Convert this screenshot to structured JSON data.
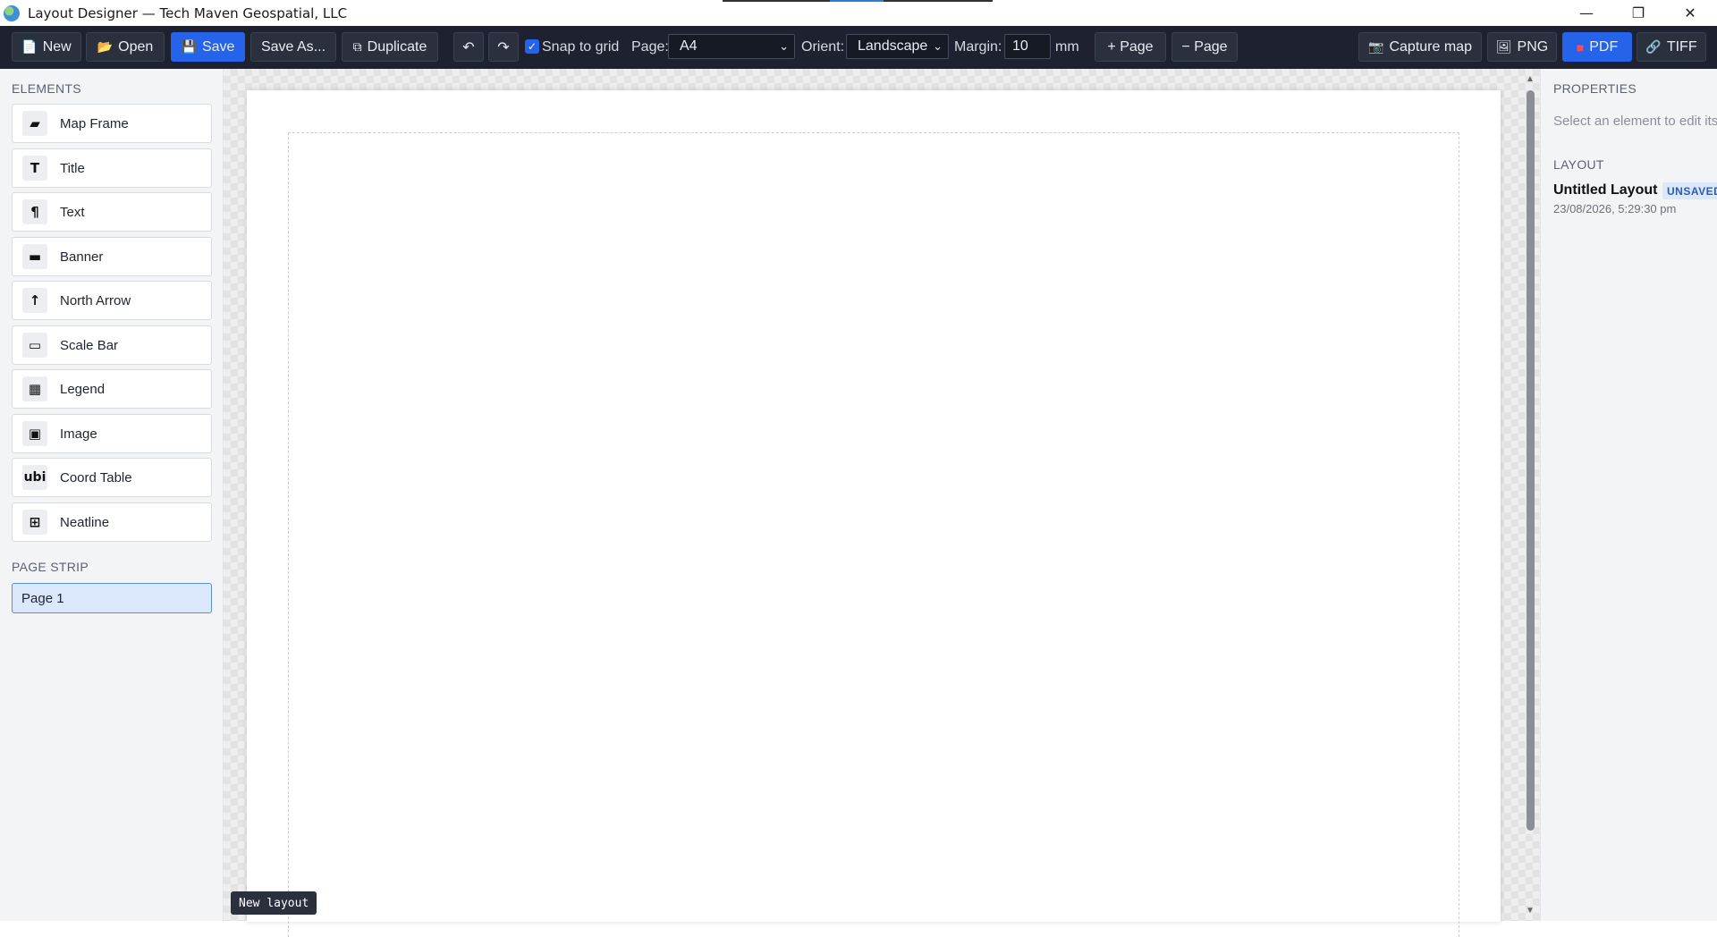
{
  "window": {
    "title": "Layout Designer — Tech Maven Geospatial, LLC",
    "controls": {
      "minimize": "—",
      "restore": "❐",
      "close": "✕"
    }
  },
  "toolbar": {
    "new": "New",
    "open": "Open",
    "save": "Save",
    "save_as": "Save As...",
    "duplicate": "Duplicate",
    "undo": "↶",
    "redo": "↷",
    "snap_to_grid": {
      "label": "Snap to grid",
      "checked": true
    },
    "page_label": "Page:",
    "page_value": "A4",
    "orient_label": "Orient:",
    "orient_value": "Landscape",
    "margin_label": "Margin:",
    "margin_value": "10",
    "margin_unit": "mm",
    "add_page": "+ Page",
    "remove_page": "− Page",
    "capture_map": "Capture map",
    "png": "PNG",
    "pdf": "PDF",
    "tiff": "TIFF",
    "accent_color": "#2563eb"
  },
  "sidebar": {
    "elements_heading": "ELEMENTS",
    "items": [
      {
        "label": "Map Frame",
        "icon": "map-frame-icon",
        "glyph": "▰"
      },
      {
        "label": "Title",
        "icon": "title-icon",
        "glyph": "T"
      },
      {
        "label": "Text",
        "icon": "text-icon",
        "glyph": "¶"
      },
      {
        "label": "Banner",
        "icon": "banner-icon",
        "glyph": "▬"
      },
      {
        "label": "North Arrow",
        "icon": "north-arrow-icon",
        "glyph": "↑"
      },
      {
        "label": "Scale Bar",
        "icon": "scale-bar-icon",
        "glyph": "▭"
      },
      {
        "label": "Legend",
        "icon": "legend-icon",
        "glyph": "▦"
      },
      {
        "label": "Image",
        "icon": "image-icon",
        "glyph": "▣"
      },
      {
        "label": "Coord Table",
        "icon": "coord-table-icon",
        "glyph": "ubi"
      },
      {
        "label": "Neatline",
        "icon": "neatline-icon",
        "glyph": "⊞"
      }
    ],
    "page_strip_heading": "PAGE STRIP",
    "pages": [
      {
        "label": "Page 1",
        "selected": true
      }
    ]
  },
  "canvas": {
    "toast": "New layout"
  },
  "properties": {
    "heading": "PROPERTIES",
    "hint": "Select an element to edit its",
    "layout_heading": "LAYOUT",
    "layout_name": "Untitled Layout",
    "status_badge": "UNSAVED",
    "timestamp": "23/08/2026, 5:29:30 pm"
  }
}
